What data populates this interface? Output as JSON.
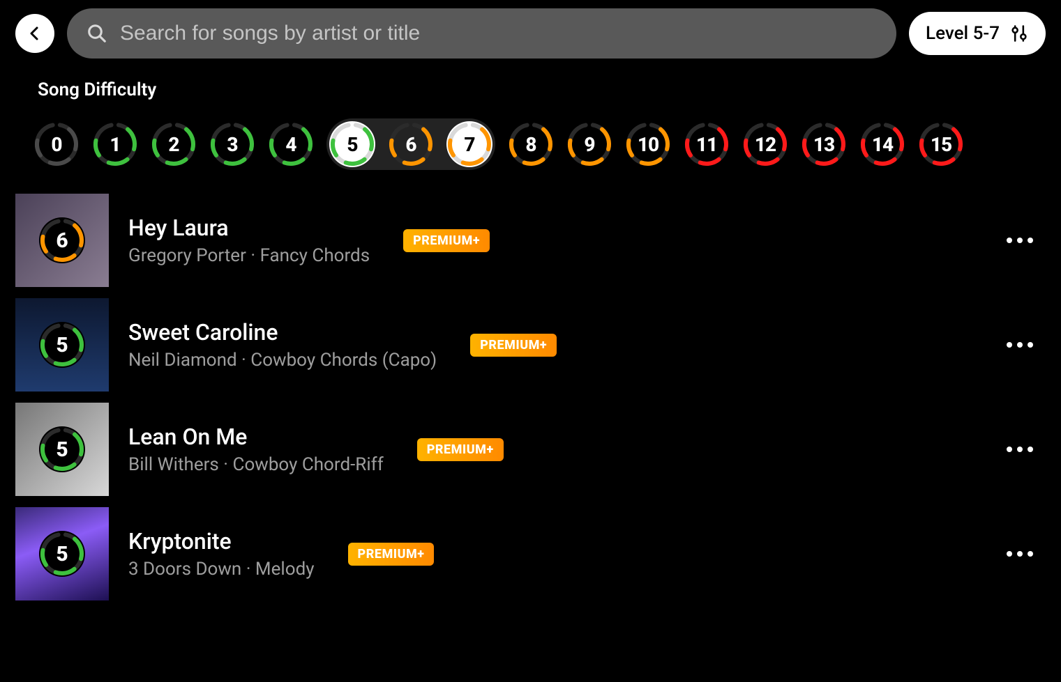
{
  "search": {
    "placeholder": "Search for songs by artist or title"
  },
  "level_filter": {
    "label": "Level 5-7"
  },
  "section_title": "Song Difficulty",
  "difficulties": [
    {
      "n": "0",
      "color": "#4a4a4a",
      "selected": false
    },
    {
      "n": "1",
      "color": "#3ec13e",
      "selected": false
    },
    {
      "n": "2",
      "color": "#3ec13e",
      "selected": false
    },
    {
      "n": "3",
      "color": "#3ec13e",
      "selected": false
    },
    {
      "n": "4",
      "color": "#3ec13e",
      "selected": false
    },
    {
      "n": "5",
      "color": "#3ec13e",
      "selected": true,
      "range": "start"
    },
    {
      "n": "6",
      "color": "#ff9500",
      "selected": false,
      "range": "mid"
    },
    {
      "n": "7",
      "color": "#ff9500",
      "selected": true,
      "range": "end"
    },
    {
      "n": "8",
      "color": "#ff9500",
      "selected": false
    },
    {
      "n": "9",
      "color": "#ff9500",
      "selected": false
    },
    {
      "n": "10",
      "color": "#ff9500",
      "selected": false
    },
    {
      "n": "11",
      "color": "#ff1a1a",
      "selected": false
    },
    {
      "n": "12",
      "color": "#ff1a1a",
      "selected": false
    },
    {
      "n": "13",
      "color": "#ff1a1a",
      "selected": false
    },
    {
      "n": "14",
      "color": "#ff1a1a",
      "selected": false
    },
    {
      "n": "15",
      "color": "#ff1a1a",
      "selected": false
    }
  ],
  "premium_label": "PREMIUM+",
  "songs": [
    {
      "title": "Hey Laura",
      "artist": "Gregory Porter",
      "style": "Fancy Chords",
      "level": "6",
      "color": "#ff9500",
      "premium": true
    },
    {
      "title": "Sweet Caroline",
      "artist": "Neil Diamond",
      "style": "Cowboy Chords (Capo)",
      "level": "5",
      "color": "#3ec13e",
      "premium": true
    },
    {
      "title": "Lean On Me",
      "artist": "Bill Withers",
      "style": "Cowboy Chord-Riff",
      "level": "5",
      "color": "#3ec13e",
      "premium": true
    },
    {
      "title": "Kryptonite",
      "artist": "3 Doors Down",
      "style": "Melody",
      "level": "5",
      "color": "#3ec13e",
      "premium": true
    }
  ]
}
